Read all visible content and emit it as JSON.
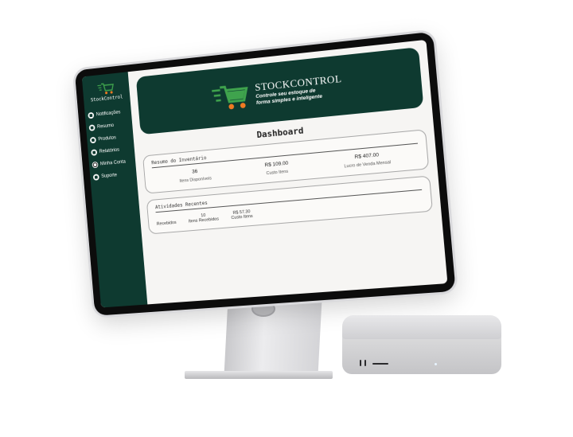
{
  "sidebar": {
    "logo_text": "StockControl",
    "items": [
      {
        "label": "Notificações",
        "icon": "bell-icon"
      },
      {
        "label": "Resumo",
        "icon": "summary-icon"
      },
      {
        "label": "Produtos",
        "icon": "box-icon"
      },
      {
        "label": "Relatórios",
        "icon": "report-icon"
      },
      {
        "label": "Minha Conta",
        "icon": "user-icon"
      },
      {
        "label": "Suporte",
        "icon": "support-icon"
      }
    ]
  },
  "banner": {
    "brand": "STOCKCONTROL",
    "tagline_line1": "Controle seu estoque de",
    "tagline_line2": "forma simples e inteligente",
    "logo_icon": "shopping-cart-icon"
  },
  "dashboard": {
    "title": "Dashboard",
    "summary": {
      "title": "Resumo do Inventário",
      "stats": [
        {
          "value": "36",
          "label": "Itens Disponíveis"
        },
        {
          "value": "R$ 109.00",
          "label": "Custo Itens"
        },
        {
          "value": "R$ 407.00",
          "label": "Lucro de Venda Mensal"
        }
      ]
    },
    "recent": {
      "title": "Atividades Recentes",
      "row_label": "Recebidos",
      "items": [
        {
          "value": "10",
          "label": "Itens Recebidos"
        },
        {
          "value": "R$ 57.30",
          "label": "Custo Itens"
        }
      ]
    }
  },
  "colors": {
    "brand_dark_green": "#0e3a30",
    "cart_green": "#3fa34d",
    "cart_wheels_orange": "#f07a22"
  }
}
